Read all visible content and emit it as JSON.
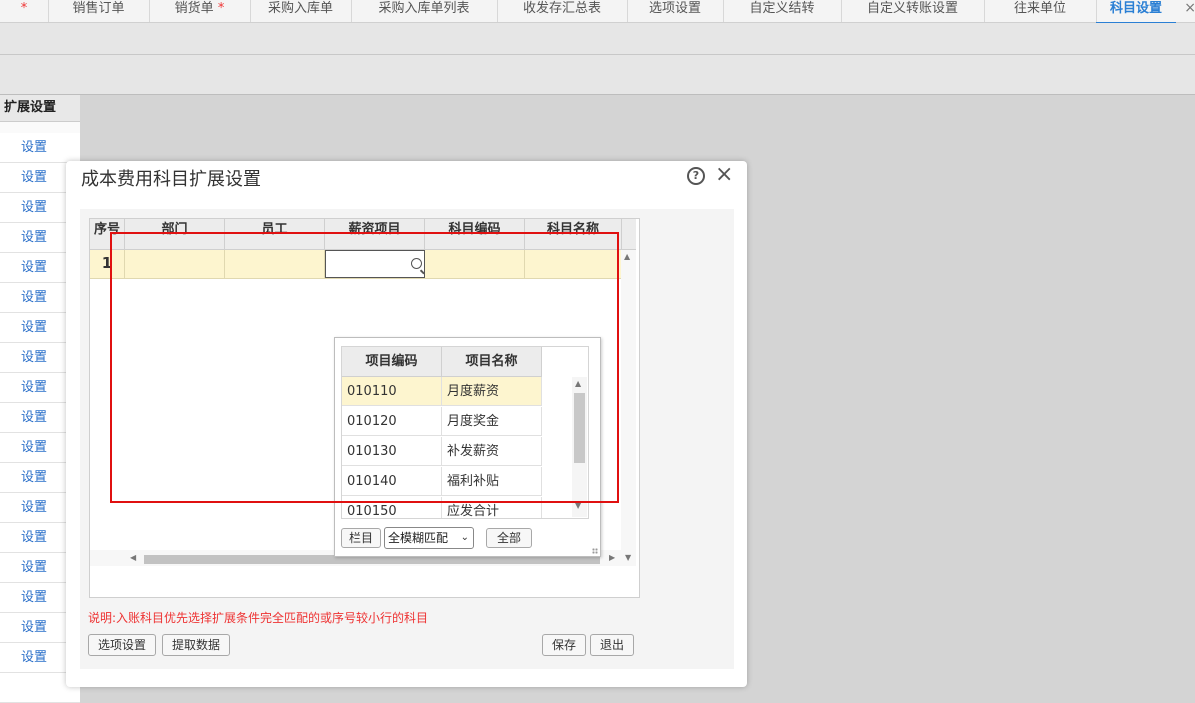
{
  "tabs": [
    {
      "label": "",
      "modified": true
    },
    {
      "label": "销售订单",
      "modified": false
    },
    {
      "label": "销货单",
      "modified": true
    },
    {
      "label": "采购入库单",
      "modified": false
    },
    {
      "label": "采购入库单列表",
      "modified": false
    },
    {
      "label": "收发存汇总表",
      "modified": false
    },
    {
      "label": "选项设置",
      "modified": false
    },
    {
      "label": "自定义结转",
      "modified": false
    },
    {
      "label": "自定义转账设置",
      "modified": false
    },
    {
      "label": "往来单位",
      "modified": false
    },
    {
      "label": "科目设置",
      "modified": false,
      "active": true
    }
  ],
  "modified_mark": "*",
  "tab_close": "×",
  "sidebar": {
    "header": "扩展设置",
    "links": [
      "设置",
      "设置",
      "设置",
      "设置",
      "设置",
      "设置",
      "设置",
      "设置",
      "设置",
      "设置",
      "设置",
      "设置",
      "设置",
      "设置",
      "设置",
      "设置",
      "设置",
      "设置"
    ]
  },
  "dialog": {
    "title": "成本费用科目扩展设置",
    "help_glyph": "?",
    "close_glyph": "×",
    "grid": {
      "columns": [
        "序号",
        "部门",
        "员工",
        "薪资项目",
        "科目编码",
        "科目名称"
      ],
      "row": {
        "no": "1"
      }
    },
    "lookup": {
      "columns": [
        "项目编码",
        "项目名称"
      ],
      "rows": [
        {
          "code": "010110",
          "name": "月度薪资"
        },
        {
          "code": "010120",
          "name": "月度奖金"
        },
        {
          "code": "010130",
          "name": "补发薪资"
        },
        {
          "code": "010140",
          "name": "福利补贴"
        },
        {
          "code": "010150",
          "name": "应发合计"
        }
      ],
      "buttons": {
        "columns": "栏目",
        "all": "全部"
      },
      "match_mode": "全模糊匹配"
    },
    "note": "说明:入账科目优先选择扩展条件完全匹配的或序号较小行的科目",
    "buttons": {
      "options": "选项设置",
      "fetch": "提取数据",
      "save": "保存",
      "exit": "退出"
    }
  },
  "colors": {
    "accent": "#2a7fd4",
    "highlight_row": "#fdf5cf",
    "note": "#e33",
    "annotation_box": "#e01010"
  }
}
